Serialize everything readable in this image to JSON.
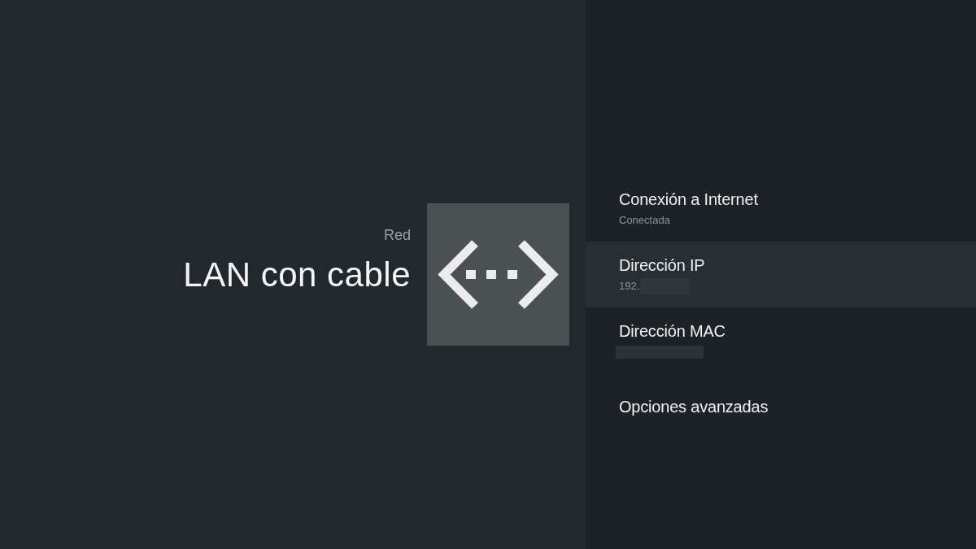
{
  "header": {
    "category": "Red",
    "title": "LAN con cable"
  },
  "items": [
    {
      "title": "Conexión a Internet",
      "value": "Conectada",
      "redacted": false,
      "selected": false
    },
    {
      "title": "Dirección IP",
      "value": "192.",
      "redacted": true,
      "selected": true
    },
    {
      "title": "Dirección MAC",
      "redacted": true,
      "selected": false
    },
    {
      "title": "Opciones avanzadas",
      "redacted": false,
      "selected": false
    }
  ]
}
